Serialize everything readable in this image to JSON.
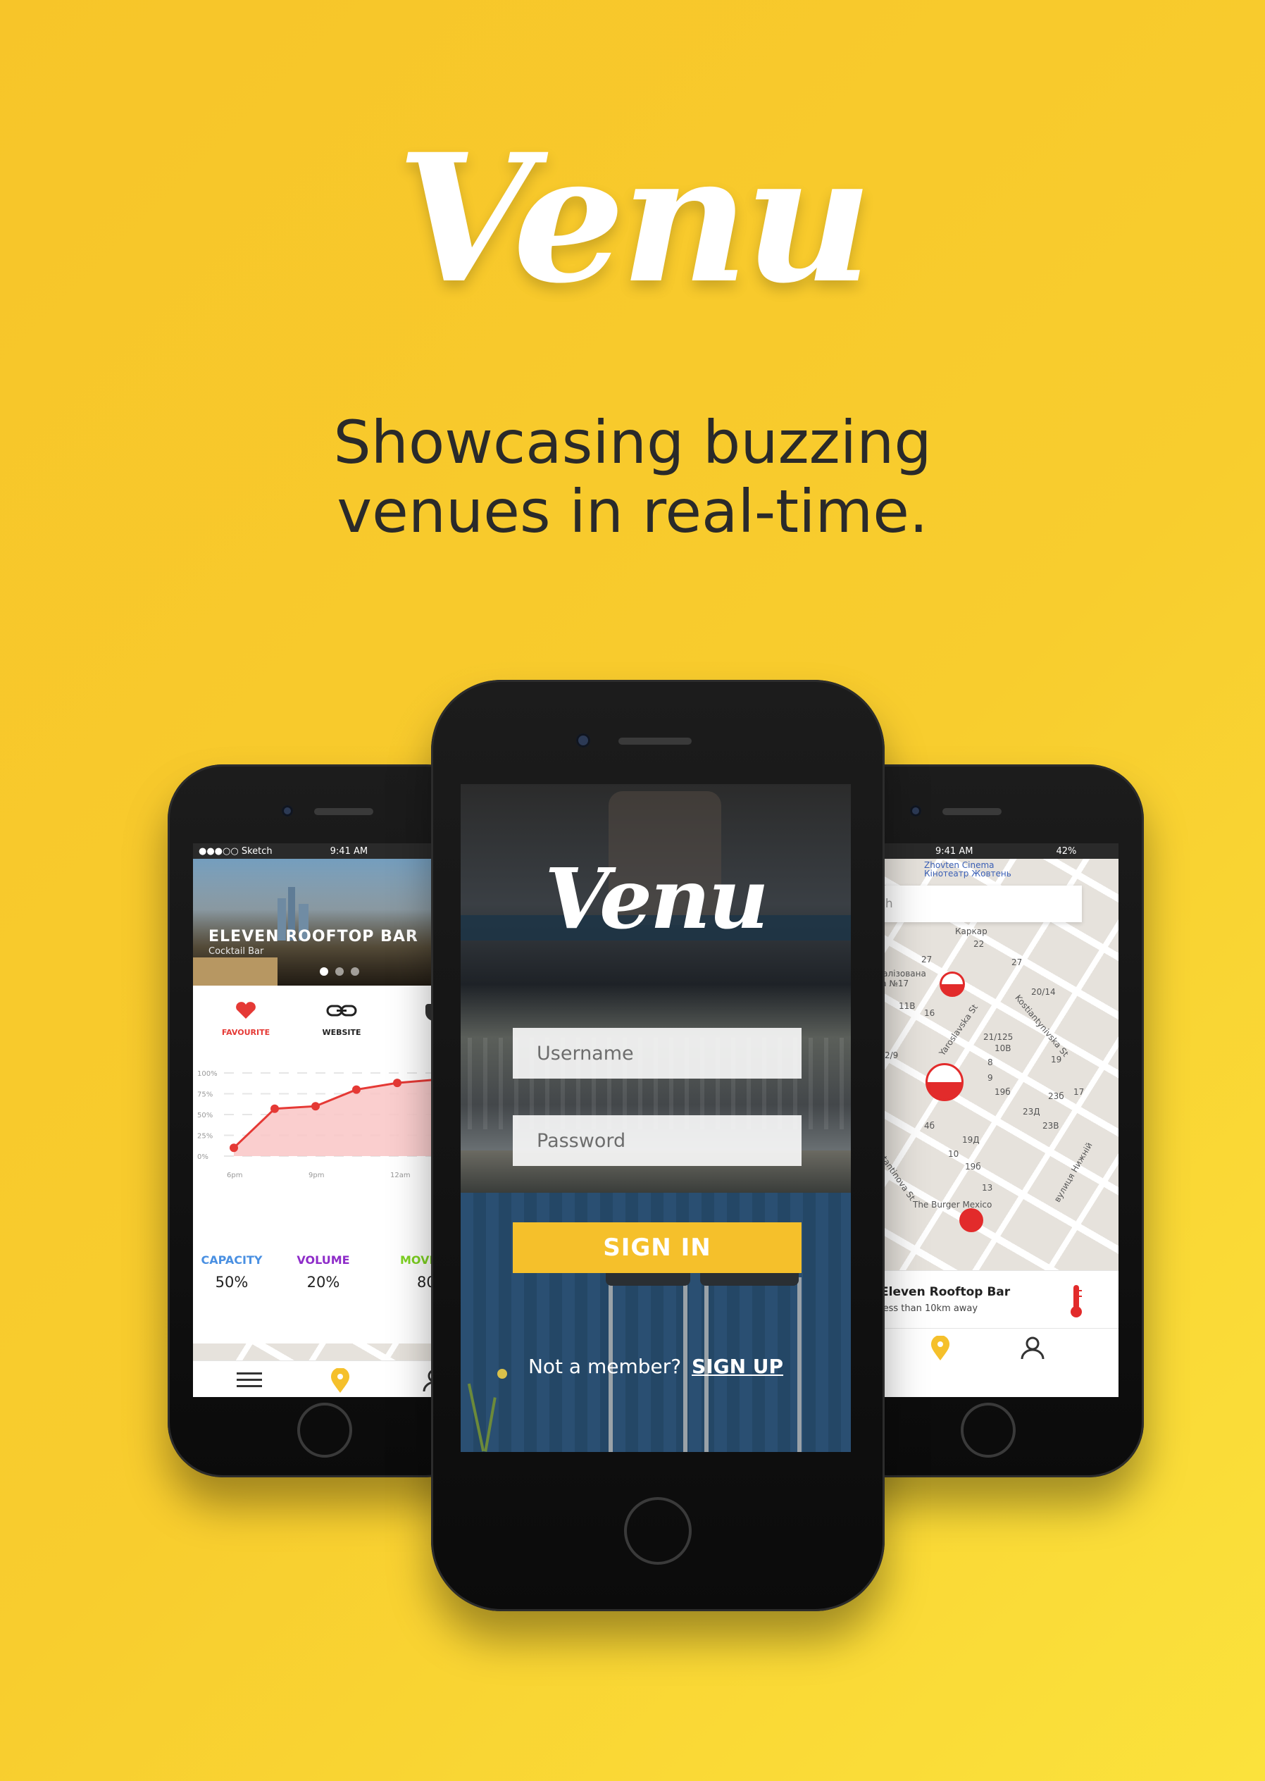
{
  "hero": {
    "logo": "Venu",
    "tagline_line1": "Showcasing buzzing",
    "tagline_line2": "venues in real-time."
  },
  "left_phone": {
    "status": {
      "carrier": "●●●○○ Sketch",
      "time": "9:41 AM"
    },
    "venue": {
      "name": "ELEVEN ROOFTOP BAR",
      "type": "Cocktail Bar"
    },
    "actions": [
      {
        "label": "FAVOURITE",
        "icon": "heart-icon",
        "color": "#e53935"
      },
      {
        "label": "WEBSITE",
        "icon": "link-icon",
        "color": "#222222"
      }
    ],
    "chart_data": {
      "type": "line",
      "x": [
        "6pm",
        "",
        "9pm",
        "",
        "12am",
        ""
      ],
      "series": [
        {
          "values": [
            10,
            57,
            60,
            80,
            88
          ]
        }
      ],
      "y_ticks": [
        "100%",
        "75%",
        "50%",
        "25%",
        "0%"
      ],
      "x_ticks": [
        "6pm",
        "9pm",
        "12am"
      ],
      "ylim": [
        0,
        100
      ],
      "line_color": "#e53935",
      "fill_color": "#f9c6c6"
    },
    "stats": [
      {
        "label": "CAPACITY",
        "value": "50%",
        "color": "#4a90e2"
      },
      {
        "label": "VOLUME",
        "value": "20%",
        "color": "#8e2cc9"
      },
      {
        "label": "MOVE",
        "value": "80",
        "color": "#7ed321"
      }
    ],
    "tabbar": {
      "menu_icon": "menu-icon",
      "pin_icon": "location-pin-icon",
      "user_icon": "user-icon"
    }
  },
  "center_phone": {
    "logo": "Venu",
    "username_placeholder": "Username",
    "password_placeholder": "Password",
    "signin_label": "SIGN IN",
    "member_prompt": "Not a member?",
    "signup_label": "SIGN UP"
  },
  "right_phone": {
    "status": {
      "time": "9:41 AM",
      "battery": "42%"
    },
    "search_placeholder": "earch",
    "map_labels": {
      "cinema1": "Zhovten Cinema",
      "cinema2": "Кінотеатр Жовтень",
      "karkar": "Каркар",
      "school1": "Спеціалізована",
      "school2": "школа №17",
      "yaroslavska": "Yaroslavska St",
      "kostiantynivska": "Kostiantynivska St",
      "konstantinova": "onstantinova St",
      "yaroslavska2": "Yaroslavska St",
      "nyzhnii": "вулиця Нижній",
      "burger": "The Burger Mexico",
      "n22": "22",
      "n27": "27",
      "n11b": "11В",
      "n16": "16",
      "n20_14": "20/14",
      "n21_125": "21/125",
      "n10b": "10В",
      "n19a": "19",
      "n2_9": "2/9",
      "n8": "8",
      "n9": "9",
      "n19b": "19б",
      "n23b": "23б",
      "n17": "17",
      "n23d": "23Д",
      "n23v": "23В",
      "n4b": "4б",
      "n19d": "19Д",
      "n10": "10",
      "n19b2": "19б",
      "n13": "13"
    },
    "card": {
      "name": "Eleven Rooftop Bar",
      "distance": "less than 10km away"
    }
  },
  "colors": {
    "background": "#f8cd2e",
    "accent_yellow": "#f5c02b",
    "red": "#e22b2b"
  }
}
